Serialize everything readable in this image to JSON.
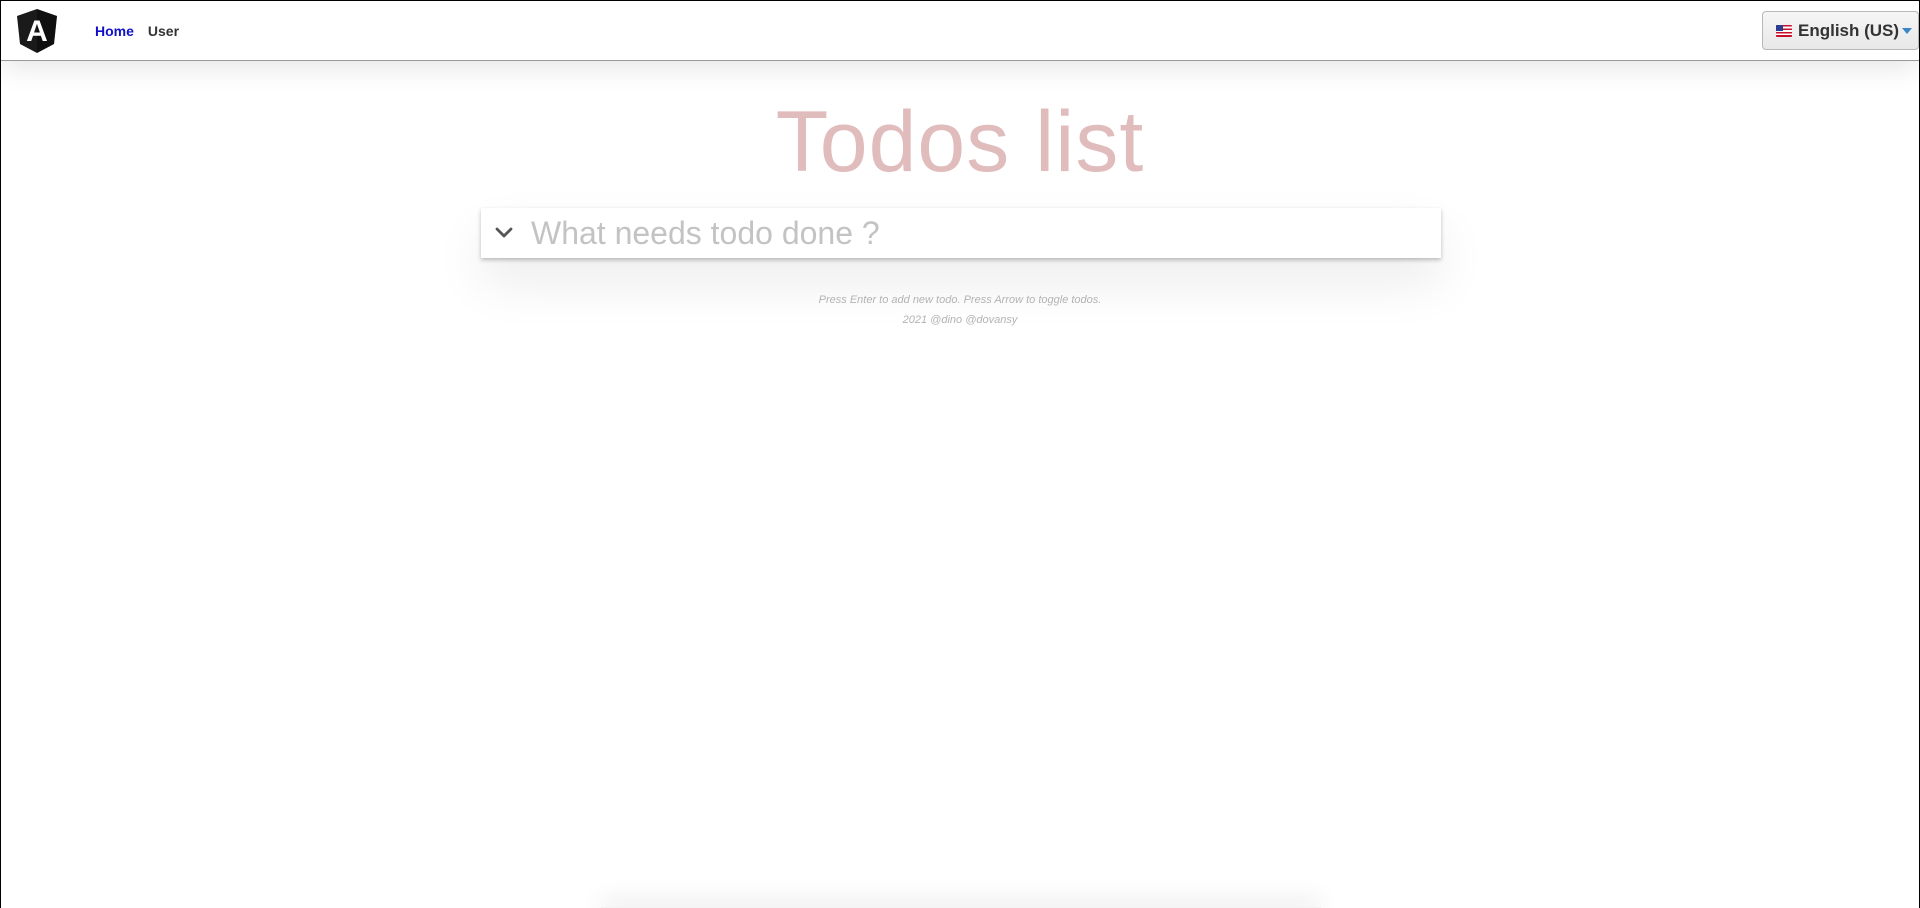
{
  "navbar": {
    "logo_letter": "A",
    "links": [
      {
        "label": "Home",
        "active": true
      },
      {
        "label": "User",
        "active": false
      }
    ],
    "language": {
      "selected": "English (US)",
      "flag": "us-flag-icon"
    }
  },
  "main": {
    "title": "Todos list",
    "input": {
      "placeholder": "What needs todo done ?",
      "value": ""
    },
    "toggle_icon": "chevron-down-icon"
  },
  "footer": {
    "hint": "Press Enter to add new todo. Press Arrow to toggle todos.",
    "credit": "2021 @dino @dovansy"
  },
  "colors": {
    "title": "#e0bcbc",
    "active_link": "#1010c8",
    "logo_dark": "#1a1a1a"
  }
}
